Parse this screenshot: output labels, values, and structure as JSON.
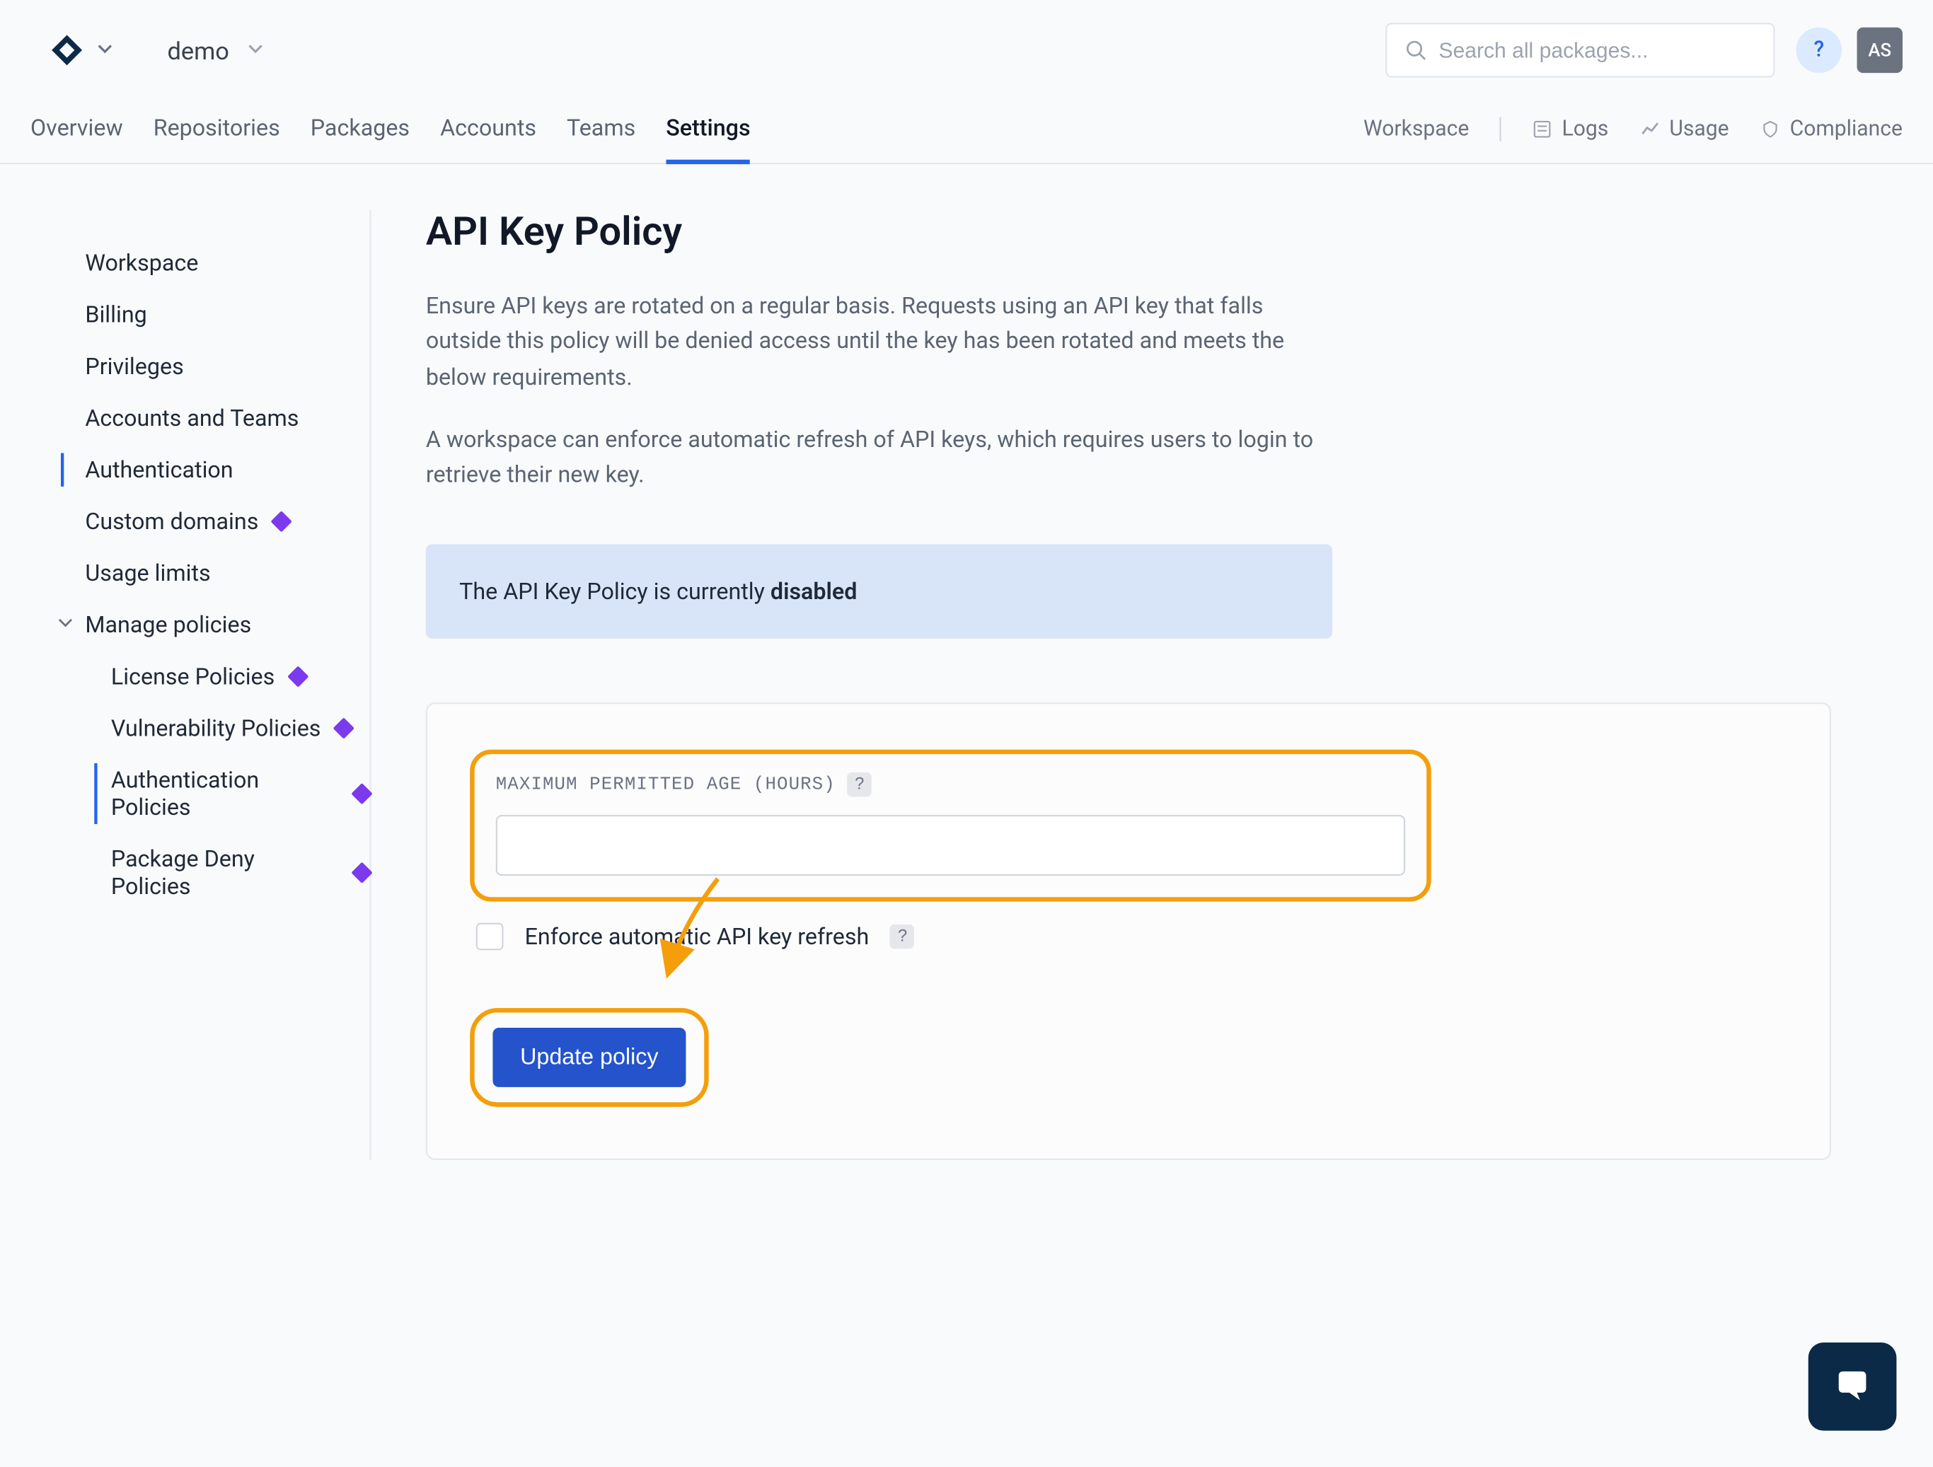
{
  "header": {
    "workspace_name": "demo",
    "search_placeholder": "Search all packages...",
    "help_label": "?",
    "avatar_initials": "AS"
  },
  "tabs": {
    "overview": "Overview",
    "repositories": "Repositories",
    "packages": "Packages",
    "accounts": "Accounts",
    "teams": "Teams",
    "settings": "Settings"
  },
  "right_links": {
    "workspace": "Workspace",
    "logs": "Logs",
    "usage": "Usage",
    "compliance": "Compliance"
  },
  "sidebar": {
    "workspace": "Workspace",
    "billing": "Billing",
    "privileges": "Privileges",
    "accounts_teams": "Accounts and Teams",
    "authentication": "Authentication",
    "custom_domains": "Custom domains",
    "usage_limits": "Usage limits",
    "manage_policies": "Manage policies",
    "license_policies": "License Policies",
    "vulnerability_policies": "Vulnerability Policies",
    "authentication_policies": "Authentication Policies",
    "package_deny_policies": "Package Deny Policies"
  },
  "page": {
    "title": "API Key Policy",
    "desc1": "Ensure API keys are rotated on a regular basis. Requests using an API key that falls outside this policy will be denied access until the key has been rotated and meets the below requirements.",
    "desc2": "A workspace can enforce automatic refresh of API keys, which requires users to login to retrieve their new key.",
    "alert_prefix": "The API Key Policy is currently ",
    "alert_state": "disabled",
    "field_label": "MAXIMUM PERMITTED AGE (HOURS)",
    "field_value": "",
    "checkbox_label": "Enforce automatic API key refresh",
    "button_label": "Update policy"
  }
}
